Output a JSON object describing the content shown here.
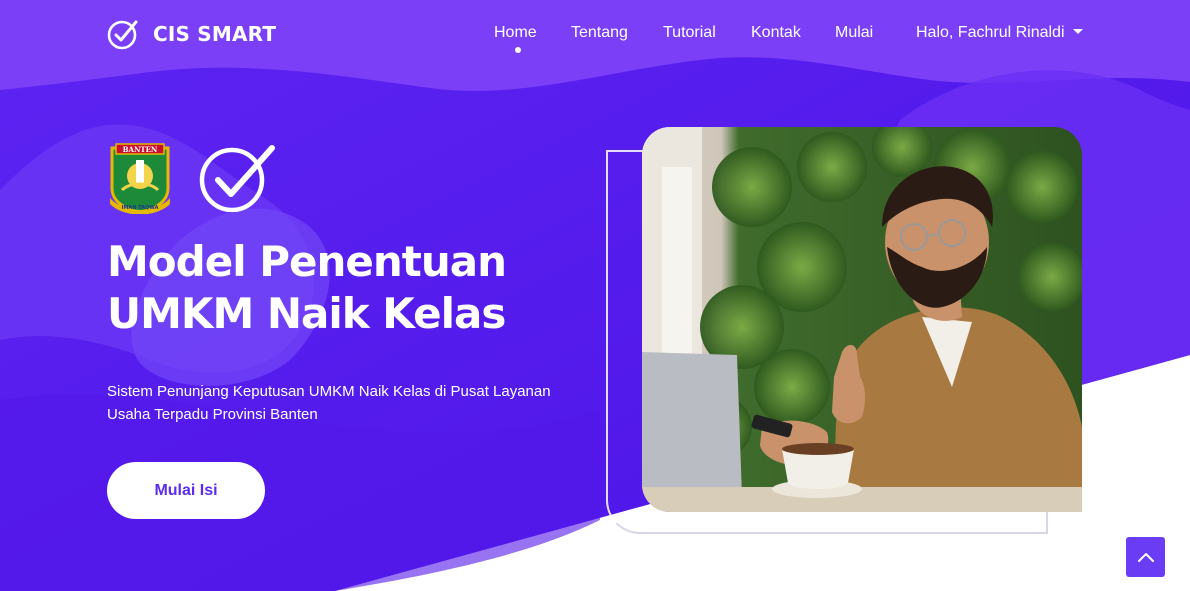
{
  "brand": {
    "name": "CIS SMART",
    "logo_icon": "check-circle-icon"
  },
  "nav": {
    "items": [
      {
        "label": "Home",
        "active": true
      },
      {
        "label": "Tentang",
        "active": false
      },
      {
        "label": "Tutorial",
        "active": false
      },
      {
        "label": "Kontak",
        "active": false
      },
      {
        "label": "Mulai",
        "active": false
      }
    ],
    "user_menu": "Halo, Fachrul Rinaldi",
    "user_menu_icon": "caret-down-icon"
  },
  "hero": {
    "emblem_text_top": "BANTEN",
    "emblem_text_bottom": "IMAN TAQWA",
    "title_line1": "Model Penentuan",
    "title_line2": "UMKM Naik Kelas",
    "description": "Sistem Penunjang Keputusan UMKM Naik Kelas di Pusat Layanan Usaha Terpadu Provinsi Banten",
    "cta_label": "Mulai Isi"
  },
  "colors": {
    "primary": "#5b2bf0",
    "primary_dark": "#4d18e8",
    "accent_light": "#7a4cf7",
    "text_on_primary": "#ffffff"
  },
  "scroll_top_icon": "chevron-up-icon"
}
